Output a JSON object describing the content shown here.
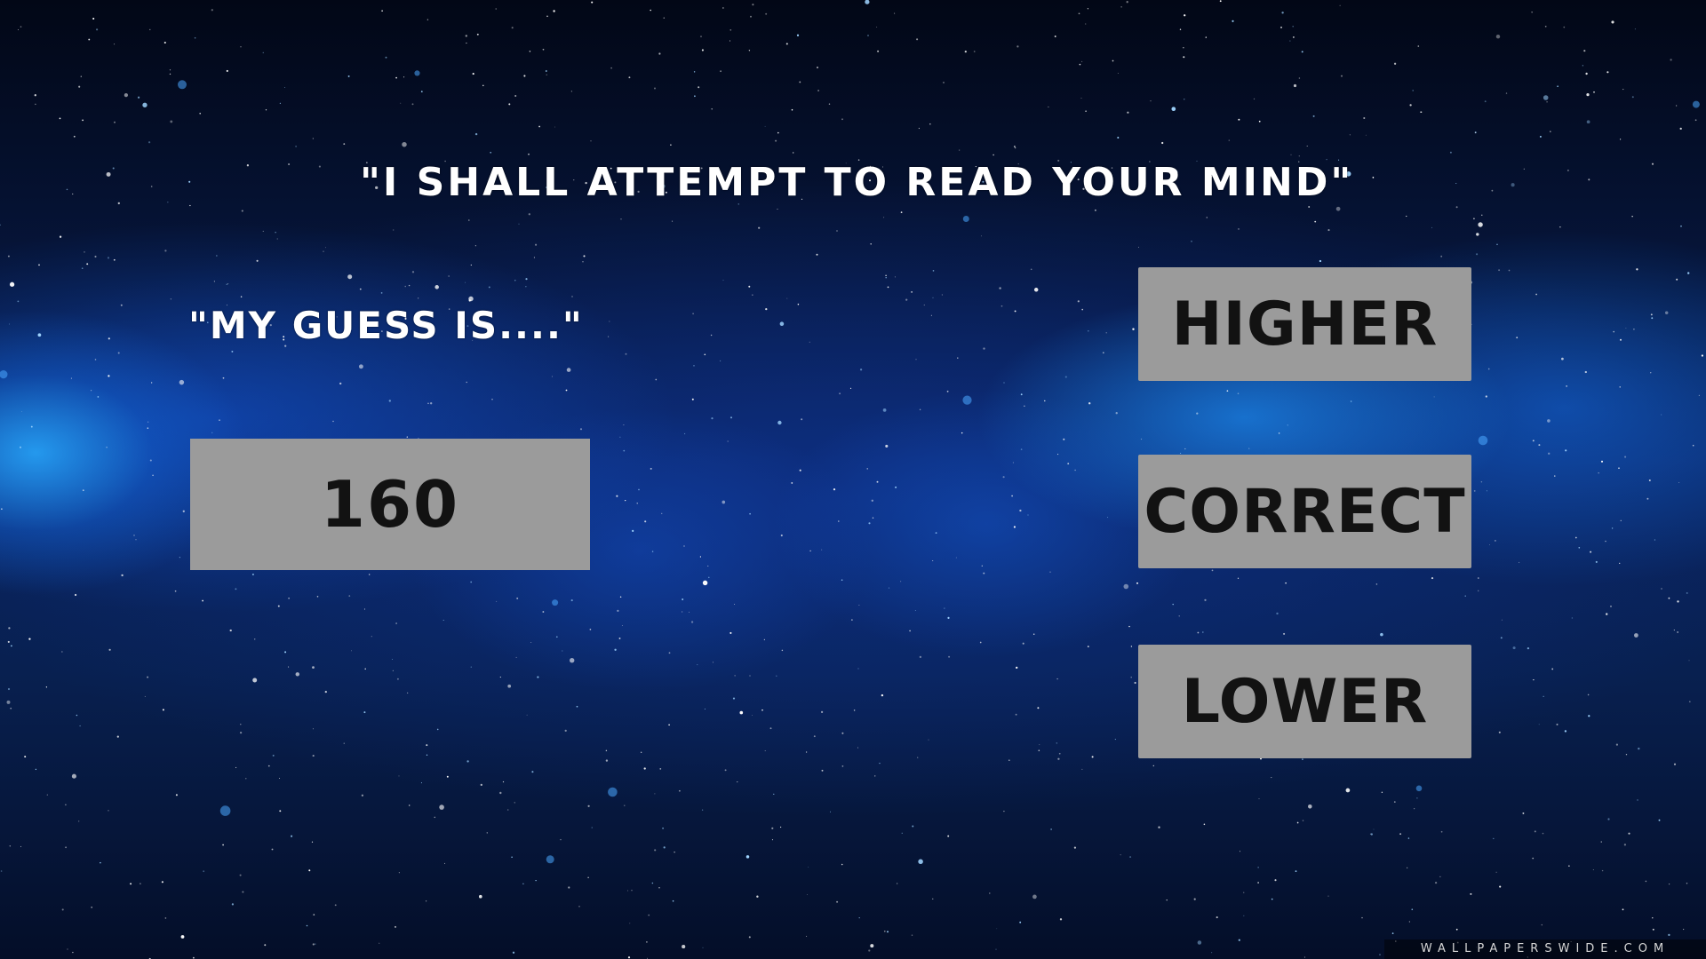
{
  "game": {
    "prompt": "\"I shall attempt to read your mind\"",
    "guess_label": "\"My guess is....\"",
    "guess_value": "160"
  },
  "buttons": {
    "higher": "Higher",
    "correct": "Correct",
    "lower": "Lower"
  },
  "watermark": "wallpaperswide.com",
  "colors": {
    "panel": "#9b9b9b",
    "panel_text": "#121212",
    "caption_text": "#ffffff",
    "background_deep": "#030b1e",
    "nebula_blue": "#28aaff"
  }
}
